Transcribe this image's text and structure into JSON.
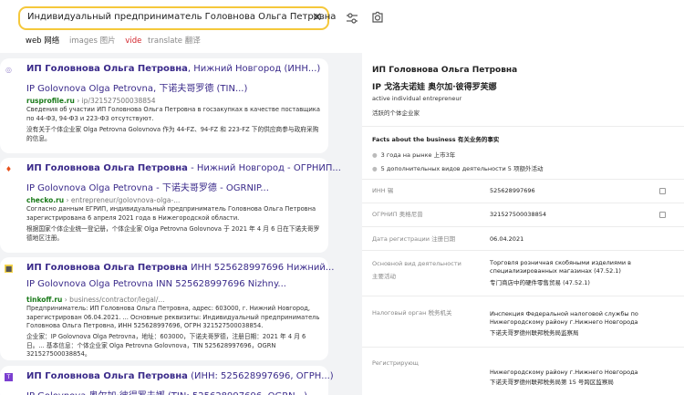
{
  "search": {
    "query": "Индивидуальный предприниматель Головнова Ольга Петровна"
  },
  "tabs": {
    "web": "web 网络",
    "images": "images 图片",
    "video": "vide",
    "translate": "translate 翻译"
  },
  "colors": {
    "accent": "#f5c83b",
    "link": "#3a2a8a",
    "url_domain": "#1a7a1a"
  },
  "results": [
    {
      "title_bold": "ИП Головнова Ольга Петровна",
      "title_rest": ", Нижний Новгород (ИНН...)",
      "title_cn": "IP Golovnova Olga Petrovna, 下诺夫哥罗德 (TIN...)",
      "domain": "rusprofile.ru",
      "path": "› ip/321527500038854",
      "snippet": "Сведения об участии ИП Головнова Ольга Петровна в госзакупках в качестве поставщика по 44-ФЗ, 94-ФЗ и 223-ФЗ отсутствуют.",
      "snippet_cn": "没有关于个体企业家 Olga Petrovna Golovnova 作为 44-FZ、94-FZ 和 223-FZ 下的供应商参与政府采购的信息。",
      "icon": "rusprofile-icon"
    },
    {
      "title_bold": "ИП Головнова Ольга Петровна",
      "title_rest": " - Нижний Новгород - ОГРНИП...",
      "title_cn": "IP Golovnova Olga Petrovna - 下诺夫哥罗德 - OGRNIP...",
      "domain": "checko.ru",
      "path": "› entrepreneur/golovnova-olga-...",
      "snippet": "Согласно данным ЕГРИП, индивидуальный предприниматель Головнова Ольга Петровна зарегистрирована 6 апреля 2021 года в Нижегородской области.",
      "snippet_cn": "根据国家个体企业统一登记册，个体企业家 Olga Petrovna Golovnova 于 2021 年 4 月 6 日在下诺夫哥罗德地区注册。",
      "icon": "checko-icon"
    },
    {
      "title_bold": "ИП Головнова Ольга Петровна",
      "title_rest": " ИНН 525628997696 Нижний...",
      "title_cn": "IP Golovnova Olga Petrovna INN 525628997696 Nizhny...",
      "domain": "tinkoff.ru",
      "path": "› business/contractor/legal/...",
      "snippet": "Предприниматель: ИП Головнова Ольга Петровна, адрес: 603000, г. Нижний Новгород, зарегистрирован 06.04.2021. ... Основные реквизиты: Индивидуальный предприниматель Головнова Ольга Петровна, ИНН 525628997696, ОГРН 321527500038854.",
      "snippet_cn": "企业家：IP Golovnova Olga Petrovna，地址：603000，下诺夫哥罗德，注册日期：2021 年 4 月 6 日。... 基本信息：个体企业家 Olga Petrovna Golovnova，TIN 525628997696，OGRN 321527500038854。",
      "icon": "tinkoff-icon"
    },
    {
      "title_bold": "ИП Головнова Ольга Петровна",
      "title_rest": " (ИНН: 525628997696, ОГРН...)",
      "title_cn": "IP Golovnova 奥尔加·彼得罗夫娜 (TIN: 525628997696, OGRN...)",
      "icon": "letter-t-icon"
    }
  ],
  "panel": {
    "title": "ИП Головнова Ольга Петровна",
    "title_cn": "IP 戈洛夫诺娃 奥尔加·彼得罗芙娜",
    "status": "active individual entrepreneur",
    "status_cn": "活跃的个体企业家",
    "facts_title": "Facts about the business 有关业务的事实",
    "facts": [
      "3 года на рынке 上市3年",
      "5 дополнительных видов деятельности 5 项额外活动"
    ],
    "rows": [
      {
        "label": "ИНН 锡",
        "value": "525628997696",
        "copy": true
      },
      {
        "label": "ОГРНИП 奥格尼普",
        "value": "321527500038854",
        "copy": true
      },
      {
        "label": "Дата регистрации 注册日期",
        "value": "06.04.2021",
        "copy": false
      },
      {
        "label": "Основной вид деятельности",
        "label2": "主要活动",
        "value": "Торговля розничная скобяными изделиями в специализированных магазинах (47.52.1)",
        "value2": "专门商店中的硬件零售贸易 (47.52.1)",
        "copy": false
      },
      {
        "label": "Налоговый орган 税务机关",
        "value": "Инспекция Федеральной налоговой службы по Нижегородскому району г.Нижнего Новгорода",
        "value2": "下诺夫哥罗德州联邦税务局监察局",
        "copy": false
      },
      {
        "label": "Регистрирующ",
        "value": "Нижегородскому району г.Нижнего Новгорода",
        "value2": "下诺夫哥罗德州联邦税务局第 15 号跨区监察局",
        "copy": false
      }
    ]
  }
}
